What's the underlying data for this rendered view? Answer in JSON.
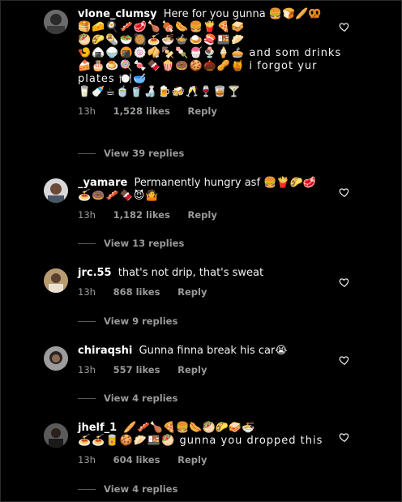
{
  "comments": [
    {
      "username": "vlone_clumsy",
      "lines": [
        "Here for you gunna 🍔🍞🥖🥨",
        "🥞🧀🍳🥓🥩🍗🍖🌭🍔🍟🍕🥪",
        "🥙🌮🌯🥗🥘🍝🍜🍲🍛🍣🍱🥟",
        "🍤🍙🍚🍘🍥🥠🍢🍡🍧🍨🍦🥧 and som drinks",
        "🍰🎂🍮🍭🍬🍫🍿🍩🍪🌰🥜🍯 i forgot yur plates 🍽️🥣",
        "🥛🍼☕🍵🥤🍶🍺🍻🥂🍷🥃🍸"
      ],
      "time": "13h",
      "likes": "1,528 likes",
      "reply": "Reply",
      "view_replies": "View 39 replies"
    },
    {
      "username": "_yamare",
      "lines": [
        "Permanently hungry asf 🍔🍟🌮🥩",
        "🍝🍩🥓🍫😈🤷"
      ],
      "time": "13h",
      "likes": "1,182 likes",
      "reply": "Reply",
      "view_replies": "View 13 replies"
    },
    {
      "username": "jrc.55",
      "lines": [
        "that's not drip, that's sweat"
      ],
      "time": "13h",
      "likes": "868 likes",
      "reply": "Reply",
      "view_replies": "View 9 replies"
    },
    {
      "username": "chiraqshi",
      "lines": [
        "Gunna finna break his car😭"
      ],
      "time": "13h",
      "likes": "557 likes",
      "reply": "Reply",
      "view_replies": "View 4 replies"
    },
    {
      "username": "jhelf_1",
      "lines": [
        "🥖🥓🍗🍕🍔🌭🥙🌮🥪🍜",
        "🍝🍝🥫🍪🥟🍱🥙 gunna you dropped this"
      ],
      "time": "13h",
      "likes": "604 likes",
      "reply": "Reply",
      "view_replies": "View 4 replies"
    }
  ],
  "icons": {
    "avatar": "avatar-photo",
    "like": "heart-icon"
  },
  "colors": {
    "background": "#000000",
    "text": "#f5f5f5",
    "muted": "#9a9a9a"
  }
}
